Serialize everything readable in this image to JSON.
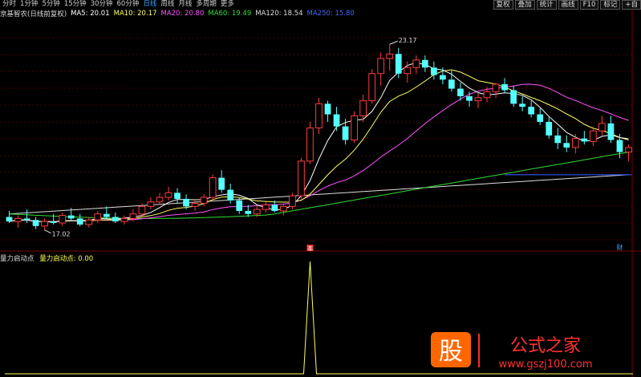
{
  "toolbar": {
    "timeframes": [
      "分时",
      "1分钟",
      "5分钟",
      "15分钟",
      "30分钟",
      "60分钟",
      "日线",
      "周线",
      "月线",
      "多周期",
      "更多"
    ],
    "active": "日线",
    "buttons": [
      "复权",
      "叠加",
      "统计",
      "画线",
      "F10",
      "标记",
      "+自"
    ]
  },
  "stock_title": "京基智农(日线前复权)",
  "ma_legend": [
    {
      "label": "MA5: 20.01",
      "color": "#ffffff"
    },
    {
      "label": "MA10: 20.17",
      "color": "#ffff66"
    },
    {
      "label": "MA20: 20.80",
      "color": "#ff55ff"
    },
    {
      "label": "MA60: 19.49",
      "color": "#33dd33"
    },
    {
      "label": "MA120: 18.54",
      "color": "#dddddd"
    },
    {
      "label": "MA250: 15.80",
      "color": "#4466ff"
    }
  ],
  "indicator": {
    "name": "量力启动点",
    "value_label": "量力启动点: 0.00",
    "color": "#ffff55"
  },
  "marks": {
    "high": "23.17",
    "low": "17.02",
    "event1": "本",
    "event2": "财"
  },
  "watermark": {
    "logo": "股",
    "text": "公式之家",
    "url": "www.gszj100.com"
  },
  "colors": {
    "up": "#ff3b3b",
    "down": "#54ffff",
    "ma5": "#ffffff",
    "ma10": "#ffff66",
    "ma20": "#ff55ff",
    "ma60": "#33dd33",
    "ma120": "#dddddd",
    "hline": "#3355ff"
  },
  "chart_data": {
    "type": "candlestick",
    "price_range": [
      16.4,
      24.0
    ],
    "candles": [
      [
        17.45,
        17.65,
        17.25,
        17.3
      ],
      [
        17.3,
        17.5,
        17.1,
        17.4
      ],
      [
        17.4,
        17.7,
        17.25,
        17.35
      ],
      [
        17.35,
        17.45,
        17.05,
        17.15
      ],
      [
        17.15,
        17.4,
        17.02,
        17.3
      ],
      [
        17.3,
        17.55,
        17.2,
        17.25
      ],
      [
        17.25,
        17.6,
        17.15,
        17.5
      ],
      [
        17.5,
        17.75,
        17.35,
        17.4
      ],
      [
        17.4,
        17.55,
        17.15,
        17.2
      ],
      [
        17.2,
        17.45,
        17.1,
        17.35
      ],
      [
        17.35,
        17.65,
        17.25,
        17.55
      ],
      [
        17.55,
        17.8,
        17.4,
        17.45
      ],
      [
        17.45,
        17.6,
        17.25,
        17.3
      ],
      [
        17.3,
        17.5,
        17.2,
        17.4
      ],
      [
        17.4,
        17.7,
        17.3,
        17.55
      ],
      [
        17.55,
        17.9,
        17.45,
        17.8
      ],
      [
        17.8,
        18.1,
        17.7,
        17.95
      ],
      [
        17.95,
        18.25,
        17.85,
        18.1
      ],
      [
        18.1,
        18.45,
        18.0,
        18.25
      ],
      [
        18.25,
        18.4,
        17.9,
        18.05
      ],
      [
        18.05,
        18.2,
        17.7,
        17.8
      ],
      [
        17.8,
        18.05,
        17.65,
        17.9
      ],
      [
        17.9,
        18.2,
        17.8,
        18.1
      ],
      [
        18.1,
        18.85,
        18.0,
        18.75
      ],
      [
        18.75,
        19.0,
        18.25,
        18.35
      ],
      [
        18.35,
        18.55,
        17.9,
        18.0
      ],
      [
        18.0,
        18.1,
        17.55,
        17.65
      ],
      [
        17.65,
        17.85,
        17.45,
        17.55
      ],
      [
        17.55,
        17.8,
        17.45,
        17.7
      ],
      [
        17.7,
        17.95,
        17.6,
        17.85
      ],
      [
        17.85,
        18.0,
        17.6,
        17.65
      ],
      [
        17.65,
        17.9,
        17.5,
        17.8
      ],
      [
        17.8,
        18.25,
        17.7,
        18.15
      ],
      [
        18.15,
        19.4,
        18.05,
        19.3
      ],
      [
        19.3,
        20.6,
        19.2,
        20.4
      ],
      [
        20.4,
        21.4,
        20.2,
        21.2
      ],
      [
        21.2,
        21.3,
        20.6,
        20.85
      ],
      [
        20.85,
        21.1,
        20.3,
        20.45
      ],
      [
        20.45,
        20.7,
        19.85,
        20.0
      ],
      [
        20.0,
        20.95,
        19.9,
        20.8
      ],
      [
        20.8,
        21.5,
        20.6,
        21.3
      ],
      [
        21.3,
        22.35,
        21.2,
        22.2
      ],
      [
        22.2,
        22.9,
        21.8,
        22.7
      ],
      [
        22.7,
        23.17,
        22.3,
        22.85
      ],
      [
        22.85,
        23.05,
        22.05,
        22.2
      ],
      [
        22.2,
        22.6,
        21.9,
        22.4
      ],
      [
        22.4,
        22.8,
        22.2,
        22.65
      ],
      [
        22.65,
        22.8,
        22.25,
        22.4
      ],
      [
        22.4,
        22.6,
        22.0,
        22.15
      ],
      [
        22.15,
        22.4,
        21.85,
        22.0
      ],
      [
        22.0,
        22.3,
        21.6,
        21.7
      ],
      [
        21.7,
        21.9,
        21.3,
        21.45
      ],
      [
        21.45,
        21.6,
        21.1,
        21.3
      ],
      [
        21.3,
        21.55,
        21.05,
        21.4
      ],
      [
        21.4,
        21.75,
        21.25,
        21.6
      ],
      [
        21.6,
        21.9,
        21.4,
        21.85
      ],
      [
        21.85,
        22.05,
        21.55,
        21.65
      ],
      [
        21.65,
        21.8,
        21.1,
        21.2
      ],
      [
        21.2,
        21.45,
        20.95,
        21.1
      ],
      [
        21.1,
        21.3,
        20.75,
        20.85
      ],
      [
        20.85,
        21.05,
        20.5,
        20.6
      ],
      [
        20.6,
        20.75,
        20.05,
        20.15
      ],
      [
        20.15,
        20.4,
        19.7,
        19.9
      ],
      [
        19.9,
        20.15,
        19.6,
        19.75
      ],
      [
        19.75,
        20.2,
        19.55,
        20.05
      ],
      [
        20.05,
        20.3,
        19.85,
        19.95
      ],
      [
        19.95,
        20.45,
        19.8,
        20.3
      ],
      [
        20.3,
        20.8,
        20.15,
        20.55
      ],
      [
        20.55,
        20.8,
        19.9,
        20.0
      ],
      [
        20.0,
        20.2,
        19.4,
        19.6
      ],
      [
        19.6,
        19.85,
        19.3,
        19.75
      ]
    ],
    "indicator_series": {
      "name": "量力启动点",
      "spike_index": 34,
      "spike_value": 1.0,
      "baseline": 0.0
    }
  }
}
